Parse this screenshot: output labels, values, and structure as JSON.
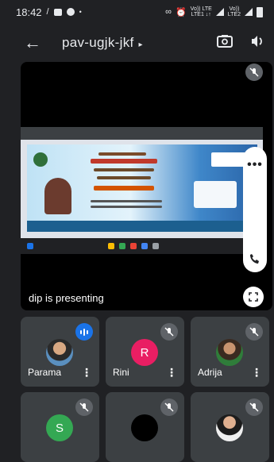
{
  "status_bar": {
    "time": "18:42",
    "network_line1": "Vo)) LTE",
    "network_line2": "LTE1 ↓↑",
    "network_line3": "Vo))",
    "network_line4": "LTE2"
  },
  "app_bar": {
    "meeting_code": "pav-ugjk-jkf",
    "caret": "▸"
  },
  "presentation": {
    "label": "dip is presenting",
    "more_label": "•••"
  },
  "participants": [
    {
      "name": "Parama",
      "avatar_type": "photo",
      "speaking": true
    },
    {
      "name": "Rini",
      "initial": "R",
      "avatar_color": "#e91e63",
      "muted": true
    },
    {
      "name": "Adrija",
      "avatar_type": "photo",
      "muted": true
    },
    {
      "name": "",
      "initial": "S",
      "avatar_color": "#34a853",
      "muted": true
    },
    {
      "name": "",
      "avatar_type": "dark",
      "muted": true
    },
    {
      "name": "",
      "avatar_type": "photo",
      "muted": true
    }
  ],
  "tile_more_label": "⋮",
  "colors": {
    "background": "#202124",
    "tile": "#3c4043",
    "mute_badge": "#5f6368",
    "speaking": "#1a73e8"
  }
}
